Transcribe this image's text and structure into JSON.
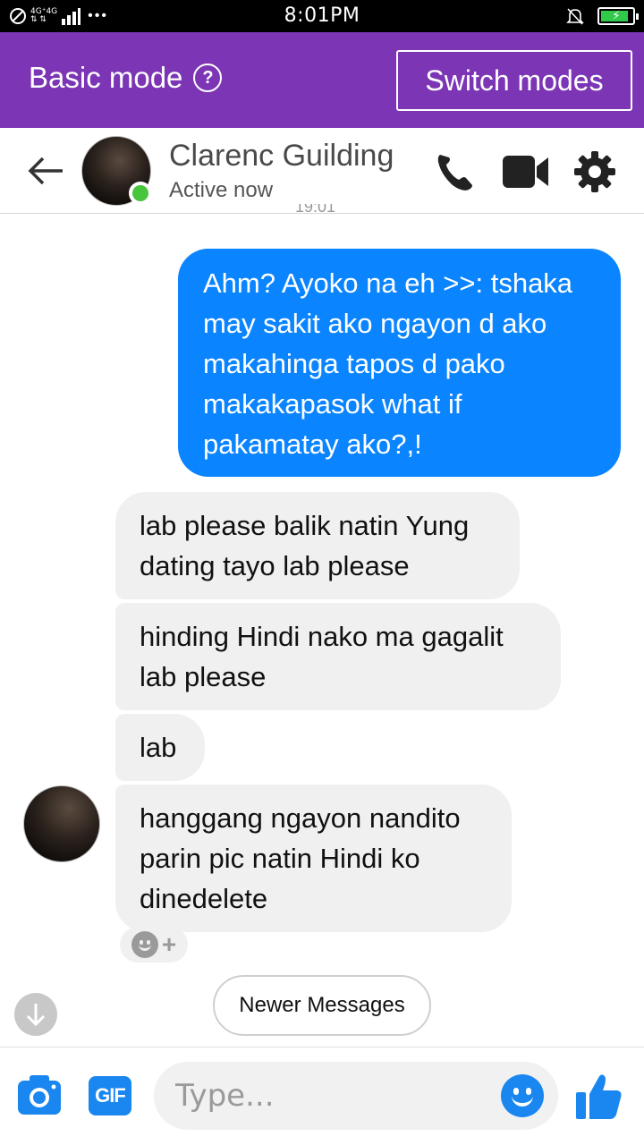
{
  "status_bar": {
    "network_top": "4G⁺4G",
    "network_bottom": "⇅ ⇅",
    "time": "8:01PM",
    "battery_level": 0.9,
    "battery_color": "#31c94a"
  },
  "mode_bar": {
    "label": "Basic mode",
    "help_icon": "?",
    "switch_label": "Switch modes",
    "background": "#7b35b5"
  },
  "header": {
    "contact_name": "Clarenc Guilding",
    "status": "Active now",
    "icons": [
      "back-arrow-icon",
      "phone-icon",
      "video-camera-icon",
      "gear-icon"
    ]
  },
  "messages": [
    {
      "direction": "outgoing",
      "lines": [
        "Ahm? Ayoko na eh >>: tshaka",
        "may sakit ako ngayon d ako",
        "makahinga tapos d pako",
        "makakapasok what if",
        "pakamatay ako?,!"
      ]
    },
    {
      "direction": "incoming",
      "lines": [
        "lab please balik natin Yung",
        "dating tayo lab please"
      ]
    },
    {
      "direction": "incoming",
      "lines": [
        "hinding Hindi nako ma gagalit",
        "lab please"
      ]
    },
    {
      "direction": "incoming",
      "lines": [
        "lab"
      ]
    },
    {
      "direction": "incoming",
      "lines": [
        "hanggang ngayon nandito",
        "parin pic natin Hindi ko",
        "dinedelete"
      ]
    }
  ],
  "colors": {
    "outgoing_bubble": "#0a84ff",
    "incoming_bubble": "#f0f0f0",
    "accent": "#1a86f0"
  },
  "newer_messages_label": "Newer Messages",
  "composer": {
    "gif_label": "GIF",
    "placeholder": "Type..."
  }
}
